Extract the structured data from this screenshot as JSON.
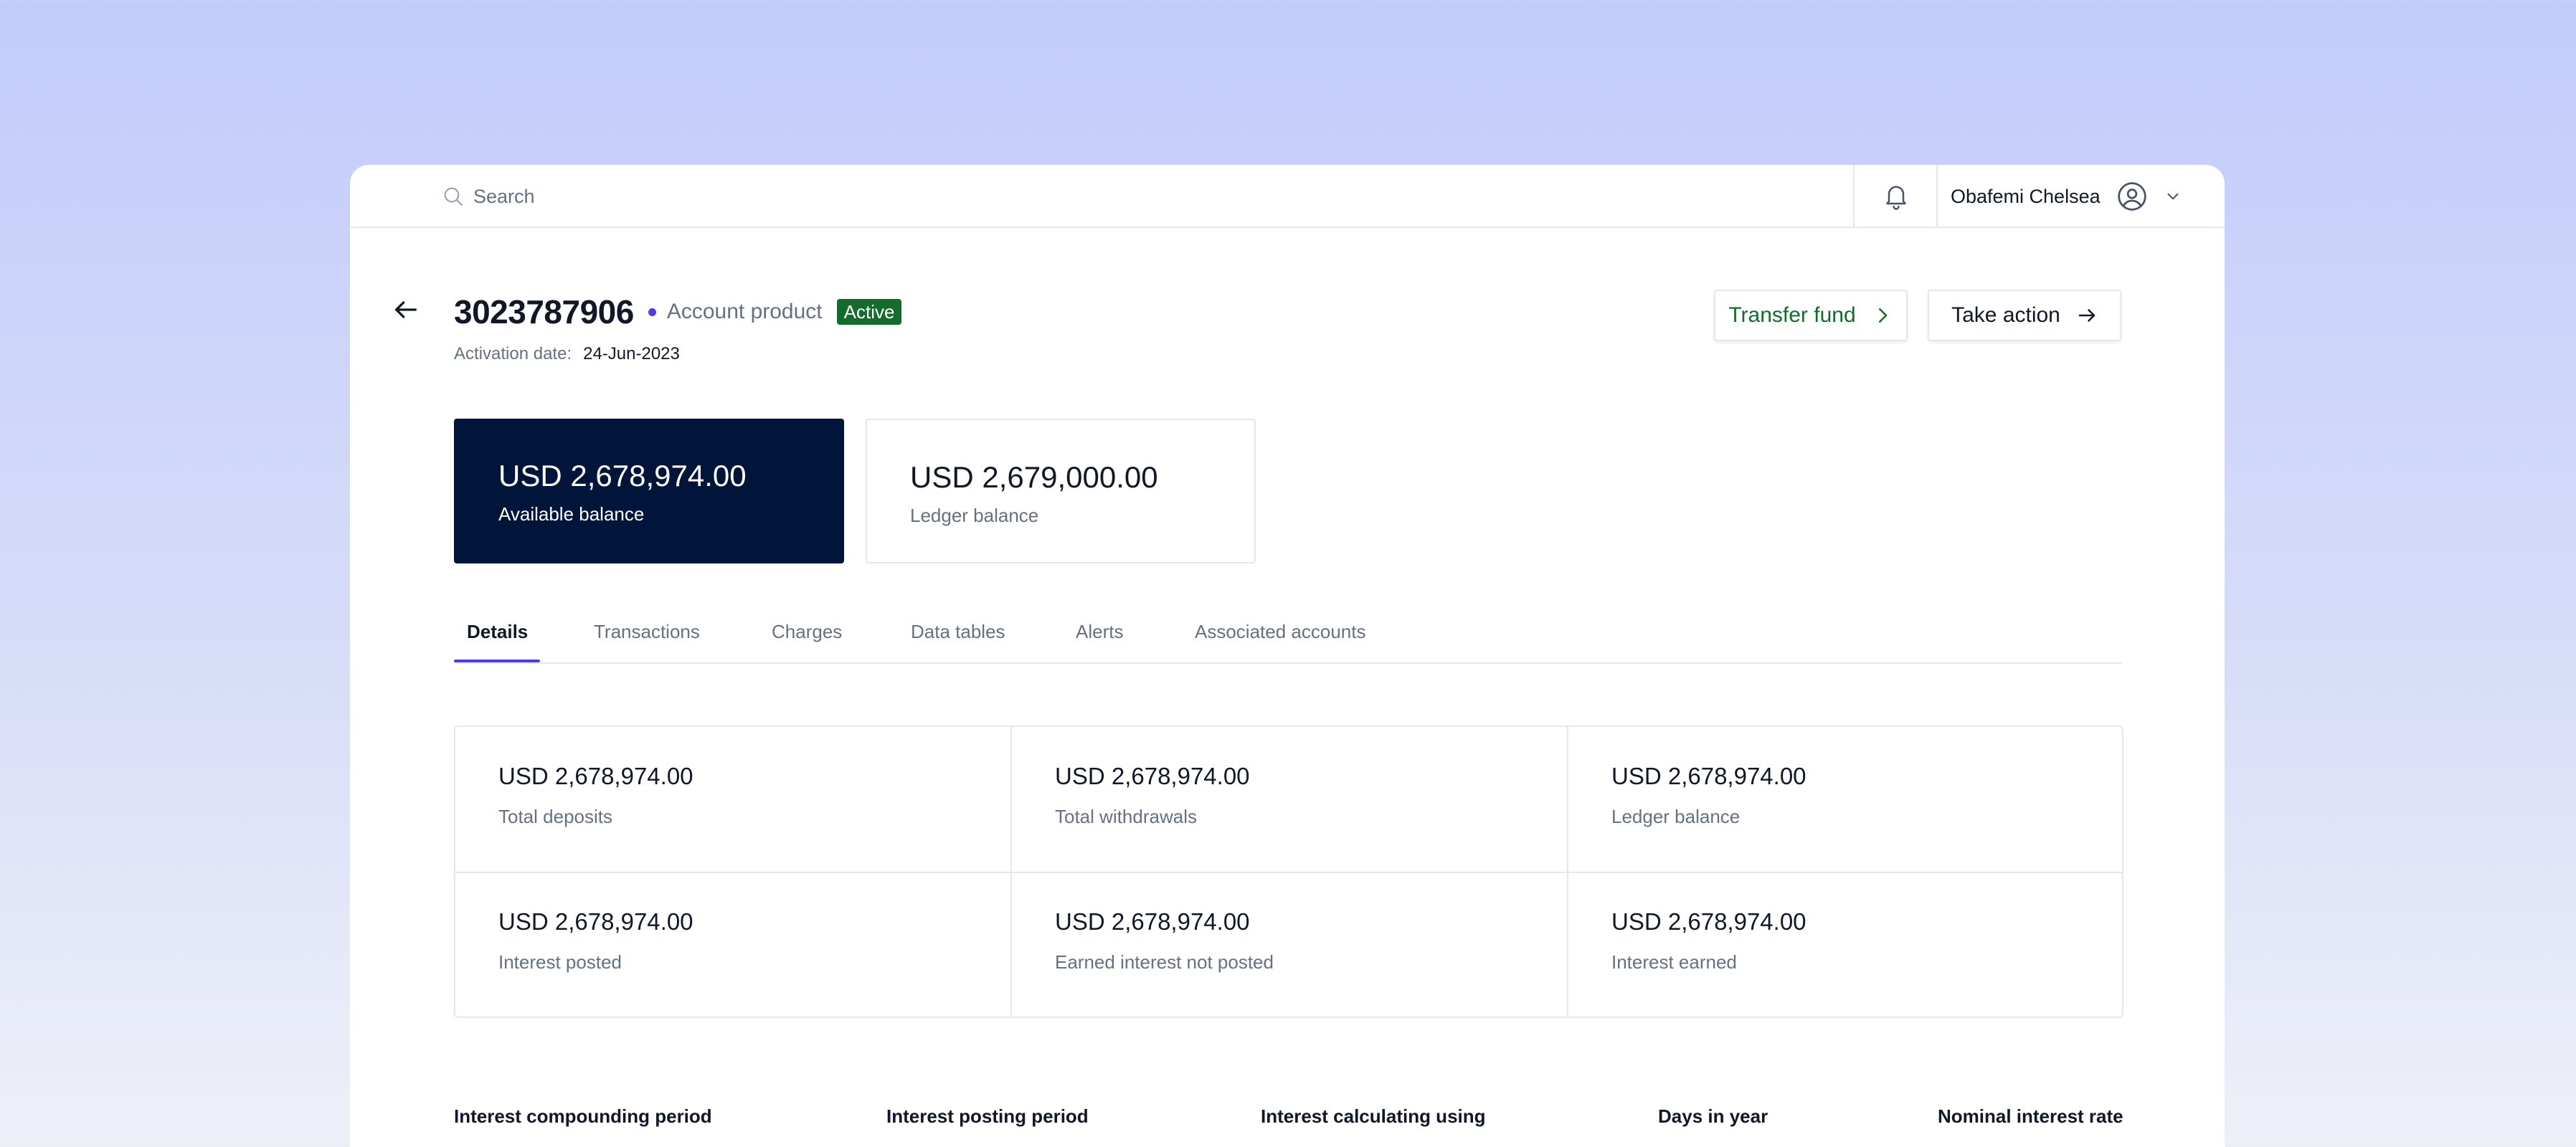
{
  "topbar": {
    "search_placeholder": "Search",
    "user_name": "Obafemi Chelsea"
  },
  "header": {
    "account_number": "3023787906",
    "account_product": "Account product",
    "status_badge": "Active",
    "activation_label": "Activation date:",
    "activation_date": "24-Jun-2023",
    "transfer_button": "Transfer fund",
    "action_button": "Take action"
  },
  "balances": {
    "available_amount": "USD 2,678,974.00",
    "available_label": "Available balance",
    "ledger_amount": "USD 2,679,000.00",
    "ledger_label": "Ledger balance"
  },
  "tabs": [
    {
      "label": "Details",
      "active": true
    },
    {
      "label": "Transactions",
      "active": false
    },
    {
      "label": "Charges",
      "active": false
    },
    {
      "label": "Data tables",
      "active": false
    },
    {
      "label": "Alerts",
      "active": false
    },
    {
      "label": "Associated accounts",
      "active": false
    }
  ],
  "stats": [
    {
      "amount": "USD 2,678,974.00",
      "label": "Total deposits"
    },
    {
      "amount": "USD 2,678,974.00",
      "label": "Total withdrawals"
    },
    {
      "amount": "USD 2,678,974.00",
      "label": "Ledger balance"
    },
    {
      "amount": "USD 2,678,974.00",
      "label": "Interest posted"
    },
    {
      "amount": "USD 2,678,974.00",
      "label": "Earned interest not posted"
    },
    {
      "amount": "USD 2,678,974.00",
      "label": "Interest earned"
    }
  ],
  "details": [
    {
      "label": "Interest compounding period"
    },
    {
      "label": "Interest posting period"
    },
    {
      "label": "Interest calculating using"
    },
    {
      "label": "Days in year"
    },
    {
      "label": "Nominal interest rate"
    }
  ],
  "colors": {
    "accent": "#4a3ee8",
    "status_green": "#146b2b",
    "navy_card": "#01153a"
  }
}
